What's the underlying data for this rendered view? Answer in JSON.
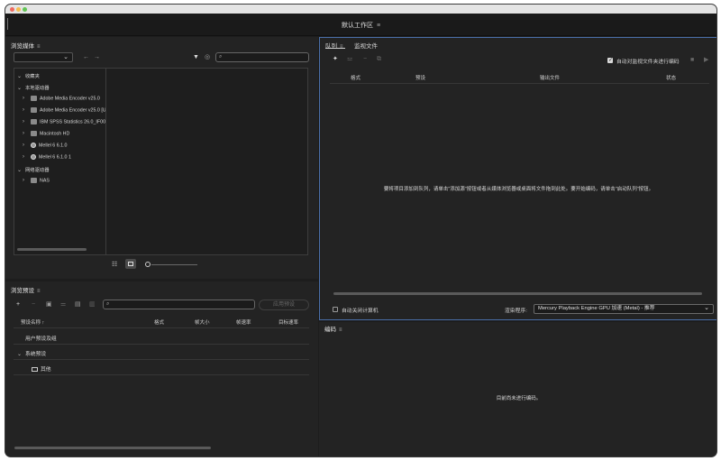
{
  "workspace": {
    "title": "默认工作区",
    "menu_icon": "hamburger-icon"
  },
  "media_browser": {
    "title": "浏览媒体",
    "tree": [
      {
        "label": "收藏夹",
        "type": "section",
        "expanded": true
      },
      {
        "label": "本地驱动器",
        "type": "section",
        "expanded": true
      },
      {
        "label": "Adobe Media Encoder v25.0",
        "type": "drive"
      },
      {
        "label": "Adobe Media Encoder v25.0 [U",
        "type": "drive"
      },
      {
        "label": "IBM SPSS Statistics 26.0_IF006",
        "type": "drive"
      },
      {
        "label": "Macintosh HD",
        "type": "drive"
      },
      {
        "label": "Mellel 6 6.1.0",
        "type": "disc"
      },
      {
        "label": "Mellel 6 6.1.0 1",
        "type": "disc"
      },
      {
        "label": "网络驱动器",
        "type": "section",
        "expanded": true
      },
      {
        "label": "NAS",
        "type": "drive"
      }
    ]
  },
  "preset_browser": {
    "title": "浏览预设",
    "search_placeholder": "",
    "apply_label": "应用预设",
    "columns": [
      "预设名称",
      "格式",
      "帧大小",
      "帧速率",
      "目标速率"
    ],
    "sort_indicator": "↑",
    "rows": [
      {
        "label": "用户预设及组",
        "level": 0
      },
      {
        "label": "系统预设",
        "level": 0,
        "expanded": true
      },
      {
        "label": "其他",
        "level": 1
      }
    ]
  },
  "queue": {
    "tabs": [
      "队列",
      "监视文件"
    ],
    "auto_encode_label": "自动对监视文件夹进行编码",
    "auto_encode_checked": true,
    "columns": [
      "格式",
      "预设",
      "输出文件",
      "状态"
    ],
    "empty_message": "要将项目添加到队列，请单击\"添加源\"按钮或者从媒体浏览器或桌面将文件拖到此处。要开始编码，请单击\"启动队列\"按钮。",
    "shutdown_label": "自动关闭计算机",
    "shutdown_checked": false,
    "renderer_label": "渲染程序:",
    "renderer_value": "Mercury Playback Engine GPU 加速 (Metal) - 推荐"
  },
  "encoding": {
    "title": "编码",
    "empty_message": "目前尚未进行编码。"
  },
  "colors": {
    "background": "#1d1d1d",
    "panel": "#232323",
    "active_panel_border": "#4a6ea8"
  }
}
